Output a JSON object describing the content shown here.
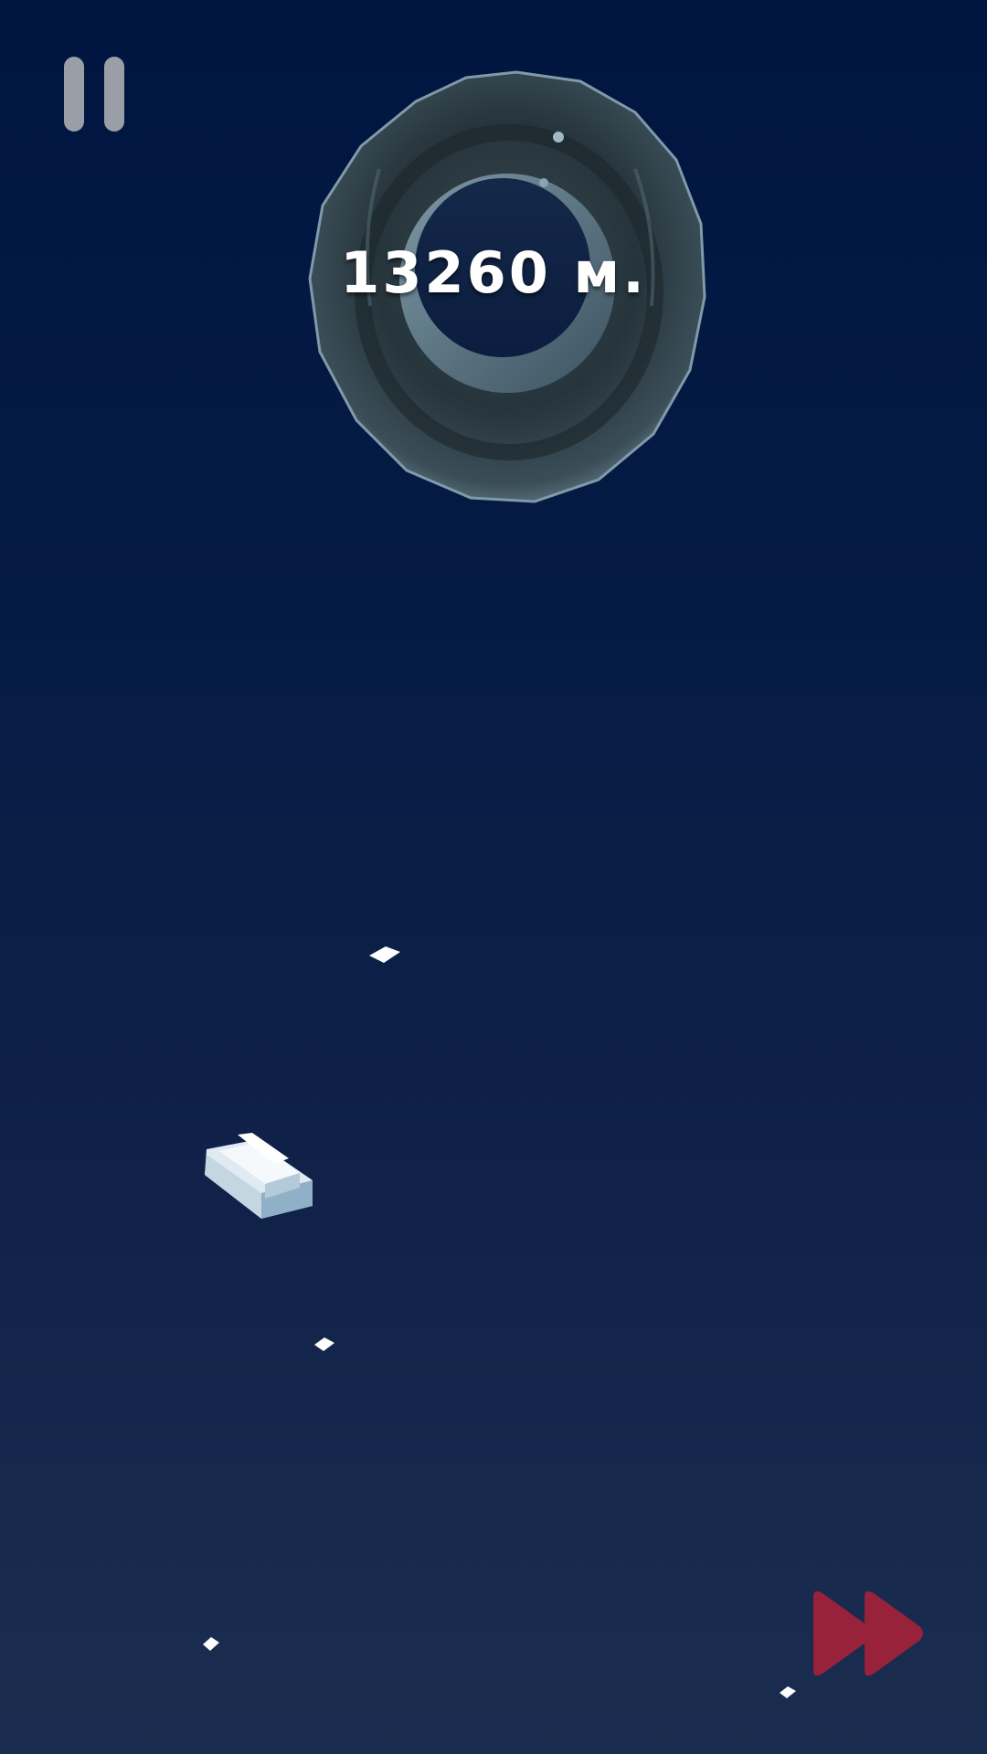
{
  "hud": {
    "distance_text": "13260 м.",
    "pause_icon": "pause-icon",
    "fast_forward_icon": "fast-forward-icon"
  },
  "colors": {
    "sky_top": "#001540",
    "sky_bottom": "#1b2d4f",
    "pause": "#9a9ea6",
    "fast_forward": "#98223a",
    "distance_text": "#ffffff"
  },
  "objects": {
    "obstacle": "tire",
    "player": "boat",
    "pickups": "ice-chips"
  }
}
